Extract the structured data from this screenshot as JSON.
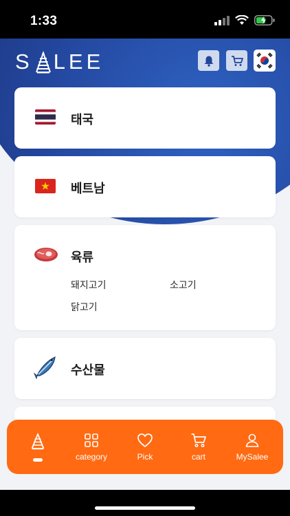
{
  "status": {
    "time": "1:33"
  },
  "header": {
    "logo_text_left": "S",
    "logo_text_right": "LEE",
    "bell_icon": "bell-icon",
    "cart_icon": "cart-icon",
    "flag_icon": "korea-flag-icon"
  },
  "categories": [
    {
      "label": "태국",
      "icon": "thailand-flag-icon"
    },
    {
      "label": "베트남",
      "icon": "vietnam-flag-icon"
    },
    {
      "label": "육류",
      "icon": "meat-icon",
      "sub": [
        "돼지고기",
        "소고기",
        "닭고기"
      ]
    },
    {
      "label": "수산물",
      "icon": "fish-icon"
    }
  ],
  "nav": {
    "items": [
      {
        "label": "",
        "icon": "home-tree-icon"
      },
      {
        "label": "category",
        "icon": "grid-icon"
      },
      {
        "label": "Pick",
        "icon": "heart-icon"
      },
      {
        "label": "cart",
        "icon": "cart-icon"
      },
      {
        "label": "MySalee",
        "icon": "user-icon"
      }
    ]
  },
  "colors": {
    "accent": "#ff6a12",
    "header_blue": "#22449a",
    "background": "#f2f3f6"
  }
}
